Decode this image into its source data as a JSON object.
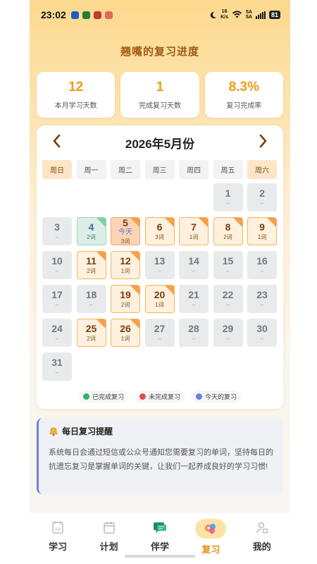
{
  "status_bar": {
    "time": "23:02",
    "net_speed_top": "16",
    "net_speed_bottom": "K/s",
    "signal1": "5A",
    "signal2": "5A",
    "battery": "81"
  },
  "title": "翘嘴的复习进度",
  "stats": [
    {
      "value": "12",
      "label": "本月学习天数"
    },
    {
      "value": "1",
      "label": "完成复习天数"
    },
    {
      "value": "8.3%",
      "label": "复习完成率"
    }
  ],
  "calendar": {
    "title": "2026年5月份",
    "prev_icon": "chevron-left-icon",
    "next_icon": "chevron-right-icon",
    "weekdays": [
      "周日",
      "周一",
      "周二",
      "周三",
      "周四",
      "周五",
      "周六"
    ],
    "leading_blanks": 5,
    "days": [
      {
        "n": "1",
        "sub": "–",
        "state": "plain"
      },
      {
        "n": "2",
        "sub": "–",
        "state": "plain"
      },
      {
        "n": "3",
        "sub": "–",
        "state": "plain"
      },
      {
        "n": "4",
        "sub": "2词",
        "state": "done"
      },
      {
        "n": "5",
        "sub": "3词",
        "state": "today",
        "tag": "今天"
      },
      {
        "n": "6",
        "sub": "3词",
        "state": "review"
      },
      {
        "n": "7",
        "sub": "1词",
        "state": "review"
      },
      {
        "n": "8",
        "sub": "2词",
        "state": "review"
      },
      {
        "n": "9",
        "sub": "1词",
        "state": "review"
      },
      {
        "n": "10",
        "sub": "–",
        "state": "plain"
      },
      {
        "n": "11",
        "sub": "2词",
        "state": "review"
      },
      {
        "n": "12",
        "sub": "1词",
        "state": "review"
      },
      {
        "n": "13",
        "sub": "–",
        "state": "plain"
      },
      {
        "n": "14",
        "sub": "–",
        "state": "plain"
      },
      {
        "n": "15",
        "sub": "–",
        "state": "plain"
      },
      {
        "n": "16",
        "sub": "–",
        "state": "plain"
      },
      {
        "n": "17",
        "sub": "–",
        "state": "plain"
      },
      {
        "n": "18",
        "sub": "–",
        "state": "plain"
      },
      {
        "n": "19",
        "sub": "2词",
        "state": "review"
      },
      {
        "n": "20",
        "sub": "1词",
        "state": "review"
      },
      {
        "n": "21",
        "sub": "–",
        "state": "plain"
      },
      {
        "n": "22",
        "sub": "–",
        "state": "plain"
      },
      {
        "n": "23",
        "sub": "–",
        "state": "plain"
      },
      {
        "n": "24",
        "sub": "–",
        "state": "plain"
      },
      {
        "n": "25",
        "sub": "2词",
        "state": "review"
      },
      {
        "n": "26",
        "sub": "1词",
        "state": "review"
      },
      {
        "n": "27",
        "sub": "–",
        "state": "plain"
      },
      {
        "n": "28",
        "sub": "–",
        "state": "plain"
      },
      {
        "n": "29",
        "sub": "–",
        "state": "plain"
      },
      {
        "n": "30",
        "sub": "–",
        "state": "plain"
      },
      {
        "n": "31",
        "sub": "–",
        "state": "plain"
      }
    ]
  },
  "legend": [
    {
      "label": "已完成复习",
      "color": "#2fb266"
    },
    {
      "label": "未完成复习",
      "color": "#e5484d"
    },
    {
      "label": "今天的复习",
      "color": "#6f7fd4"
    }
  ],
  "reminder": {
    "icon": "bell-icon",
    "title": "每日复习提醒",
    "text": "系统每日会通过短信或公众号通知您需要复习的单词，坚持每日的抗遗忘复习是掌握单词的关键，让我们一起养成良好的学习习惯!"
  },
  "tabs": [
    {
      "label": "学习",
      "icon": "study-icon",
      "active": false
    },
    {
      "label": "计划",
      "icon": "calendar-icon",
      "active": false
    },
    {
      "label": "伴学",
      "icon": "chat-icon",
      "active": false
    },
    {
      "label": "复习",
      "icon": "review-icon",
      "active": true
    },
    {
      "label": "我的",
      "icon": "profile-icon",
      "active": false
    }
  ],
  "colors": {
    "accent": "#ef9a1a",
    "title": "#a05a14",
    "done": "#2fb266",
    "undone": "#e5484d",
    "today": "#6f7fd4"
  }
}
